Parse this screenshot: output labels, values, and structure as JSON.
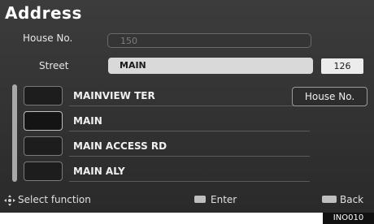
{
  "title": "Address",
  "house_no": {
    "label": "House No.",
    "value": "150"
  },
  "street": {
    "label": "Street",
    "value": "MAIN",
    "count": "126"
  },
  "results": [
    "MAINVIEW TER",
    "MAIN",
    "MAIN ACCESS RD",
    "MAIN ALY"
  ],
  "house_no_button": "House No.",
  "footer": {
    "select": "Select function",
    "enter": "Enter",
    "back": "Back"
  },
  "image_code": "INO010"
}
